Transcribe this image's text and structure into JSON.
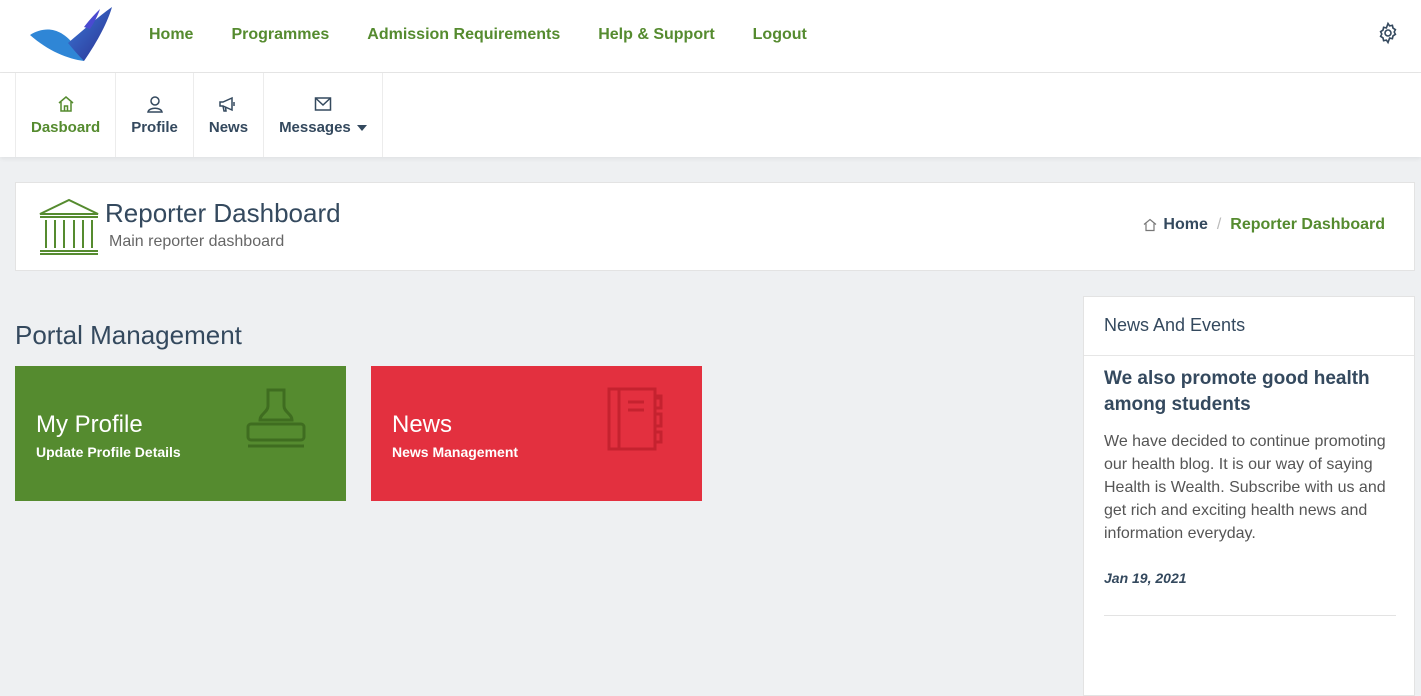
{
  "nav": {
    "links": [
      "Home",
      "Programmes",
      "Admission Requirements",
      "Help & Support",
      "Logout"
    ]
  },
  "subnav": {
    "tabs": [
      {
        "label": "Dasboard",
        "icon": "home-icon"
      },
      {
        "label": "Profile",
        "icon": "user-icon"
      },
      {
        "label": "News",
        "icon": "megaphone-icon"
      },
      {
        "label": "Messages",
        "icon": "envelope-icon"
      }
    ]
  },
  "header": {
    "title": "Reporter Dashboard",
    "subtitle": "Main reporter dashboard",
    "breadcrumb": {
      "home": "Home",
      "separator": "/",
      "current": "Reporter Dashboard"
    }
  },
  "portal": {
    "title": "Portal Management",
    "tiles": [
      {
        "title": "My Profile",
        "subtitle": "Update Profile Details",
        "color": "#558b2f",
        "icon": "stamp-icon"
      },
      {
        "title": "News",
        "subtitle": "News Management",
        "color": "#e3303f",
        "icon": "notebook-icon"
      }
    ]
  },
  "news": {
    "heading": "News And Events",
    "item": {
      "title": "We also promote good health among students",
      "text": "We have decided to continue promoting our health blog. It is our way of saying Health is Wealth. Subscribe with us and get rich and exciting health news and information everyday.",
      "date": "Jan 19, 2021"
    }
  },
  "colors": {
    "accent": "#558b2f",
    "danger": "#e3303f",
    "text": "#34495e"
  }
}
